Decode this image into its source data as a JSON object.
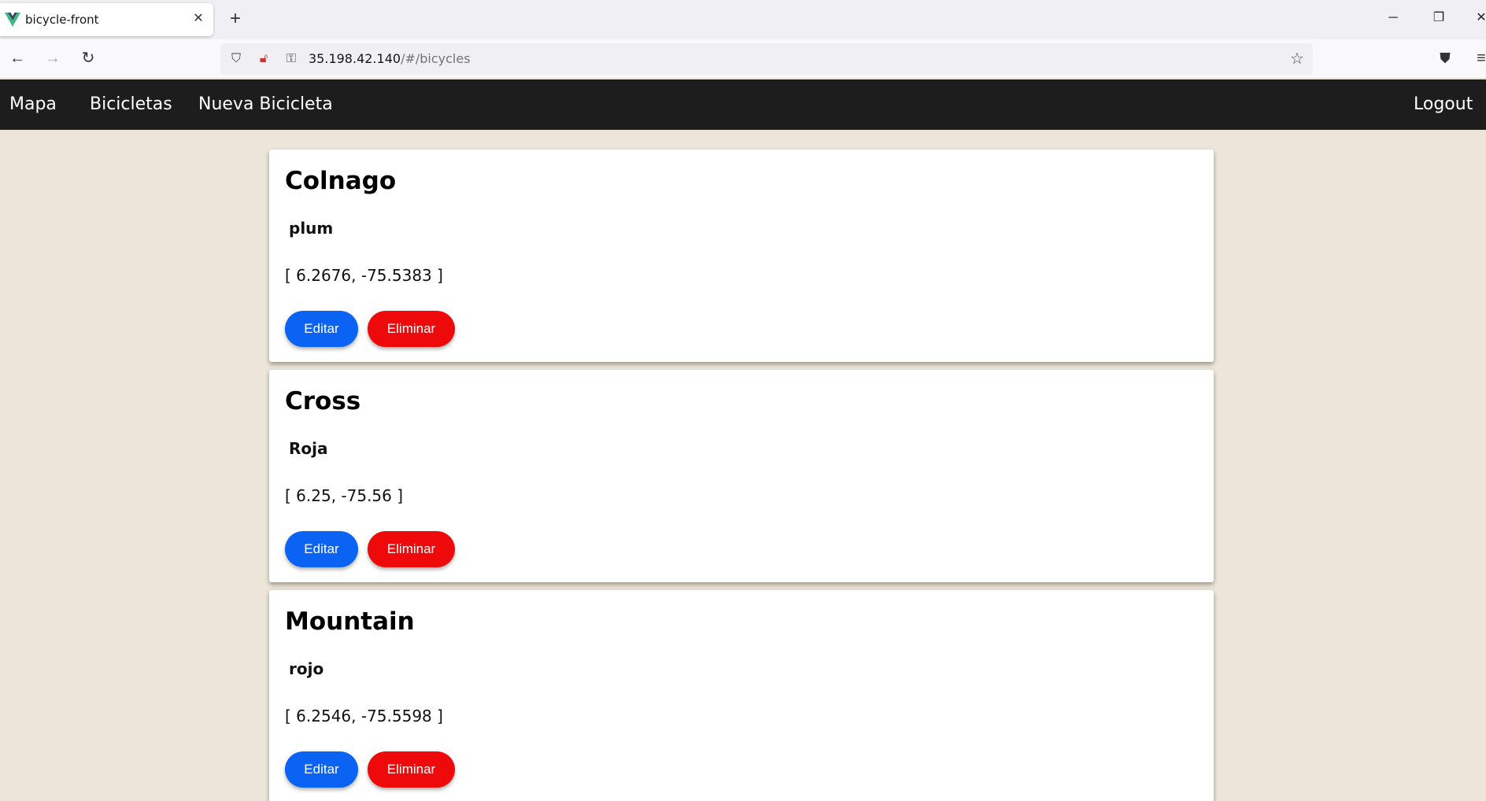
{
  "browser": {
    "tab_title": "bicycle-front",
    "url_host": "35.198.42.140",
    "url_path": "/#/bicycles"
  },
  "app_nav": {
    "links": [
      "Mapa",
      "Bicicletas",
      "Nueva Bicicleta"
    ],
    "logout": "Logout"
  },
  "bicycles": [
    {
      "model": "Colnago",
      "color": "plum",
      "location": "[ 6.2676, -75.5383 ]"
    },
    {
      "model": "Cross",
      "color": "Roja",
      "location": "[ 6.25, -75.56 ]"
    },
    {
      "model": "Mountain",
      "color": "rojo",
      "location": "[ 6.2546, -75.5598 ]"
    }
  ],
  "actions": {
    "edit_label": "Editar",
    "delete_label": "Eliminar"
  },
  "colors": {
    "nav_bg": "#1d1d1d",
    "page_bg": "#ece5d8",
    "edit_button": "#0a63f2",
    "delete_button": "#ee0a0a"
  },
  "icons": {
    "favicon": "vue-logo-icon",
    "close": "close-icon",
    "new_tab": "plus-icon",
    "back": "back-arrow-icon",
    "forward": "forward-arrow-icon",
    "reload": "reload-icon",
    "shield": "shield-icon",
    "insecure": "insecure-lock-icon",
    "key": "key-icon",
    "bookmark": "star-icon",
    "pocket": "pocket-icon",
    "menu": "hamburger-menu-icon"
  }
}
